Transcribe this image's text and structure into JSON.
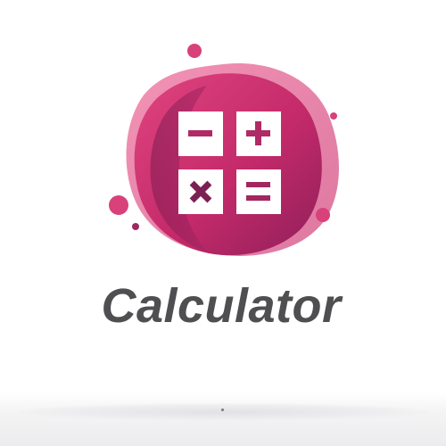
{
  "brand": {
    "name": "Calculator",
    "colors": {
      "primary": "#c8306e",
      "light": "#e04a84",
      "dark": "#8a2057",
      "text": "#4f4f52",
      "tile": "#ffffff"
    }
  },
  "keys": [
    {
      "icon": "minus-icon"
    },
    {
      "icon": "plus-icon"
    },
    {
      "icon": "multiply-icon"
    },
    {
      "icon": "equals-icon"
    }
  ]
}
